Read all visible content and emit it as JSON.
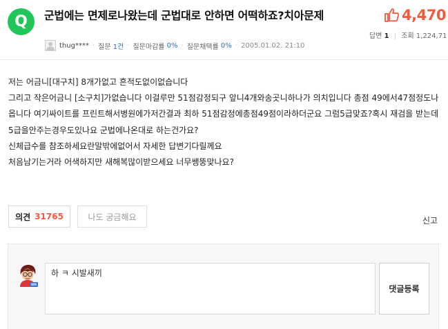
{
  "question": {
    "badge": "Q",
    "title": "군법에는 면제로나왔는데 군법대로 안하면 어떡하죠?치아문제",
    "likes": "4,470",
    "answers_label": "답변",
    "answers_count": "1",
    "views_label": "조회",
    "views_count": "1,224,71"
  },
  "meta": {
    "user": "thug****",
    "question_label": "질문",
    "question_value": "1건",
    "close_rate_label": "질문마감률",
    "close_rate_value": "0%",
    "adopt_rate_label": "질문채택률",
    "adopt_rate_value": "0%",
    "date": "2005.01.02. 21:10"
  },
  "body": {
    "line1": "저는 어금니[대구치] 8개가없고 흔적도없이없습니다",
    "line2": "그리고 작은어금니 [소구치]가없습니다 이걸루만 51점감정되구 앞니4개와송곳니하나가 의치입니다 총점 49에서47점정도나옵니다 여기싸이트를 프린트해서병원에가저간결과 최하 51점감정에총점49점이라하더군요 그럼5급맞죠?혹시 재검을 받는데 5급을안주는경우도있나요 군법에나온대로 하는건가요?",
    "line3": "신체급수를 참조하세요란말밖에없어서 자세한 답변기다릴께요",
    "line4": "처음남기는거라 어색하지만 새해복많이받으세요 너무쌩뚱맞나요?"
  },
  "actions": {
    "opinion_label": "의견",
    "opinion_count": "31765",
    "curious_label": "나도 궁금해요",
    "report_label": "신고"
  },
  "comment": {
    "input_value": "하 ㅋ 시발새끼",
    "submit_label": "댓글등록"
  },
  "colors": {
    "badge_green": "#21c65a",
    "accent_red": "#f25a3e",
    "link_blue": "#2c6fce"
  }
}
